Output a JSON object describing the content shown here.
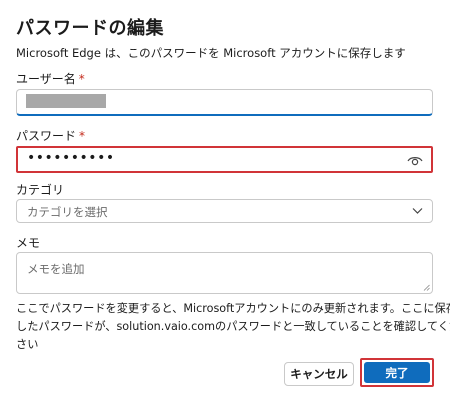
{
  "dialog": {
    "title": "パスワードの編集",
    "subtitle": "Microsoft Edge は、このパスワードを Microsoft アカウントに保存します"
  },
  "username": {
    "label": "ユーザー名",
    "required_mark": "*"
  },
  "password": {
    "label": "パスワード",
    "required_mark": "*",
    "value": "••••••••••"
  },
  "category": {
    "label": "カテゴリ",
    "placeholder": "カテゴリを選択"
  },
  "memo": {
    "label": "メモ",
    "placeholder": "メモを追加"
  },
  "note": {
    "line1": "ここでパスワードを変更すると、Microsoftアカウントにのみ更新されます。ここに保存",
    "line2": "したパスワードが、solution.vaio.comのパスワードと一致していることを確認してくだ",
    "line3": "さい"
  },
  "buttons": {
    "cancel": "キャンセル",
    "done": "完了"
  },
  "colors": {
    "accent": "#0f6cbd",
    "highlight": "#d13438",
    "required": "#c42b1c"
  },
  "icons": {
    "reveal": "eye-icon",
    "dropdown": "chevron-down-icon"
  }
}
